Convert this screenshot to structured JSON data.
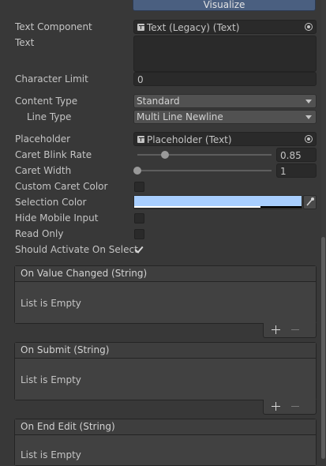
{
  "visualize_button": "Visualize",
  "fields": {
    "text_component": {
      "label": "Text Component",
      "value": "Text (Legacy) (Text)"
    },
    "text": {
      "label": "Text",
      "value": ""
    },
    "character_limit": {
      "label": "Character Limit",
      "value": "0"
    },
    "content_type": {
      "label": "Content Type",
      "value": "Standard"
    },
    "line_type": {
      "label": "Line Type",
      "value": "Multi Line Newline"
    },
    "placeholder": {
      "label": "Placeholder",
      "value": "Placeholder (Text)"
    },
    "caret_blink_rate": {
      "label": "Caret Blink Rate",
      "value": "0.85"
    },
    "caret_width": {
      "label": "Caret Width",
      "value": "1"
    },
    "custom_caret_color": {
      "label": "Custom Caret Color",
      "checked": false
    },
    "selection_color": {
      "label": "Selection Color",
      "color": "#a8cefe"
    },
    "hide_mobile_input": {
      "label": "Hide Mobile Input",
      "checked": false
    },
    "read_only": {
      "label": "Read Only",
      "checked": false
    },
    "should_activate_on_select": {
      "label": "Should Activate On Select",
      "checked": true
    }
  },
  "events": [
    {
      "title": "On Value Changed (String)",
      "empty": "List is Empty"
    },
    {
      "title": "On Submit (String)",
      "empty": "List is Empty"
    },
    {
      "title": "On End Edit (String)",
      "empty": "List is Empty"
    }
  ]
}
